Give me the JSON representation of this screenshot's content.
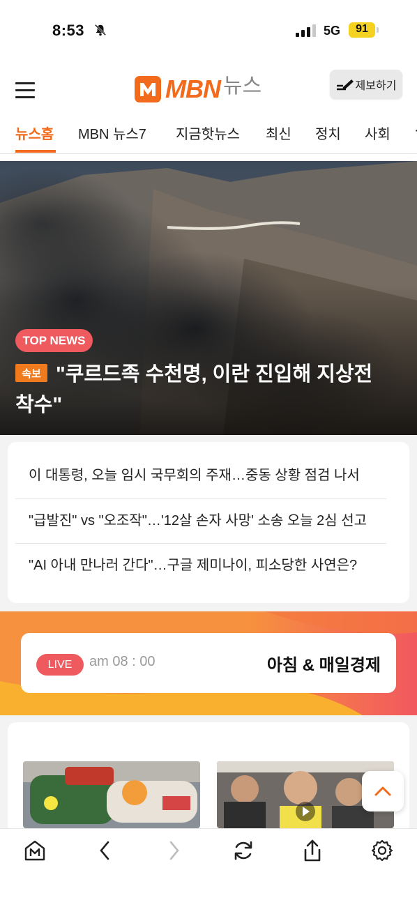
{
  "status": {
    "time": "8:53",
    "network": "5G",
    "battery": "91"
  },
  "header": {
    "logo_text": "MBN",
    "logo_sub": "뉴스",
    "report_label": "제보하기"
  },
  "nav_tabs": [
    "뉴스홈",
    "MBN 뉴스7",
    "지금핫뉴스",
    "최신",
    "정치",
    "사회"
  ],
  "hero": {
    "badge": "TOP NEWS",
    "breaking_label": "속보",
    "headline": "\"쿠르드족 수천명, 이란 진입해 지상전 착수\""
  },
  "news_list": [
    "이 대통령, 오늘 임시 국무회의 주재…중동 상황 점검 나서",
    "\"급발진\" vs \"오조작\"…'12살 손자 사망' 소송 오늘 2심 선고",
    "\"AI 아내 만나러 간다\"…구글 제미나이, 피소당한 사연은?"
  ],
  "live": {
    "badge": "LIVE",
    "time": "am 08 : 00",
    "program": "아침 & 매일경제"
  },
  "colors": {
    "brand": "#f26a1b",
    "badge_red": "#ef5a5f",
    "battery": "#f5d21f"
  },
  "icons": [
    "menu-icon",
    "pen-icon",
    "bell-slash-icon",
    "signal-icon",
    "home-m-icon",
    "back-icon",
    "forward-icon",
    "refresh-icon",
    "share-icon",
    "settings-icon",
    "chevron-up-icon",
    "play-icon"
  ]
}
